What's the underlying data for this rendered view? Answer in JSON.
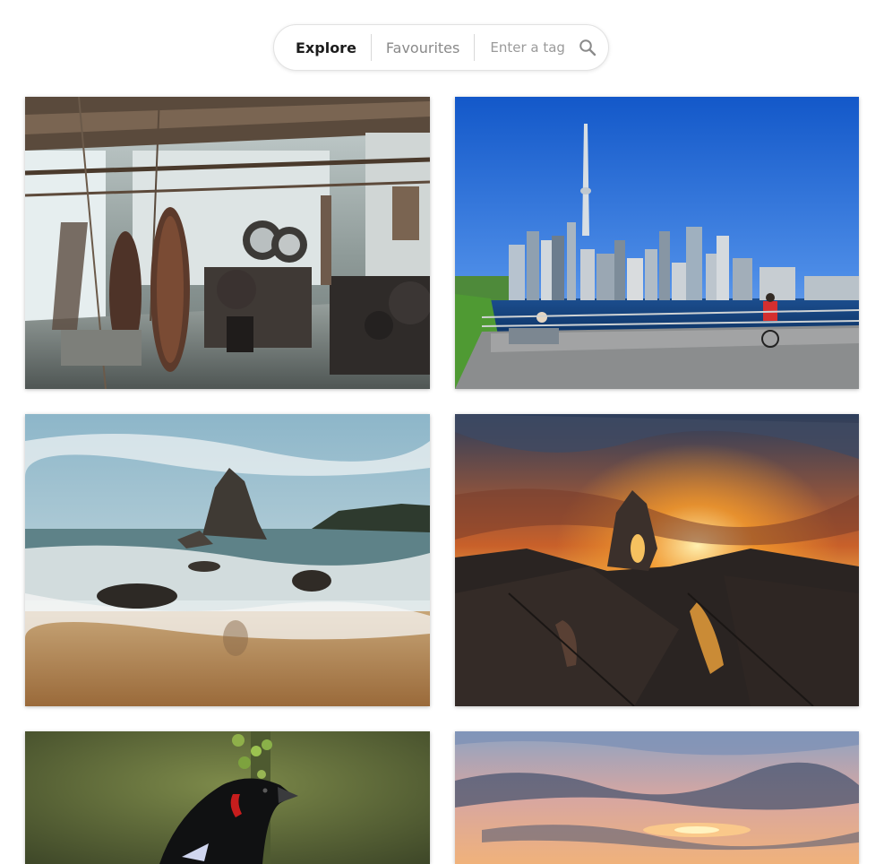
{
  "nav": {
    "tabs": [
      {
        "label": "Explore",
        "active": true
      },
      {
        "label": "Favourites",
        "active": false
      }
    ],
    "search": {
      "placeholder": "Enter a tag",
      "value": "",
      "icon": "search-icon"
    }
  },
  "gallery": {
    "photos": [
      {
        "subject": "industrial-machinery-hall"
      },
      {
        "subject": "city-skyline-waterfront"
      },
      {
        "subject": "beach-sea-stacks"
      },
      {
        "subject": "rock-arch-sunset"
      },
      {
        "subject": "black-bird-red-shoulder"
      },
      {
        "subject": "sunset-sky-reflection"
      }
    ]
  },
  "colors": {
    "active_tab": "#1c1c1c",
    "inactive_tab": "#8a8a8a",
    "bar_border": "#e2e2e2"
  }
}
